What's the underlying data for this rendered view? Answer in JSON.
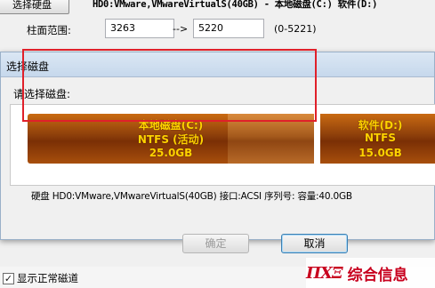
{
  "app": {
    "select_disk_button": "选择硬盘",
    "disk_info": "HD0:VMware,VMwareVirtualS(40GB) - 本地磁盘(C:) 软件(D:)",
    "cylinder_label": "柱面范围:",
    "cylinder_from": "3263",
    "cylinder_arrow": "-->",
    "cylinder_to": "5220",
    "cylinder_range": "(0-5221)",
    "show_normal_checkbox": "显示正常磁道",
    "show_normal_checked": true
  },
  "dialog": {
    "title": "选择磁盘",
    "prompt": "请选择磁盘:",
    "partitions": [
      {
        "name": "本地磁盘(C:)",
        "fs": "NTFS (活动)",
        "size": "25.0GB",
        "selected": true
      },
      {
        "name": "软件(D:)",
        "fs": "NTFS",
        "size": "15.0GB",
        "selected": false
      }
    ],
    "disk_line": "硬盘 HD0:VMware,VMwareVirtualS(40GB)   接口:ACSI  序列号:  容量:40.0GB",
    "ok_button": "确定",
    "cancel_button": "取消",
    "ok_disabled": true
  },
  "watermark": {
    "logo": "ΠΧΞ",
    "text": "综合信息"
  },
  "colors": {
    "partition_fill": "#8a3d0a",
    "partition_text": "#ffd200",
    "selection_border": "#e0202a",
    "watermark": "#c8001e"
  }
}
